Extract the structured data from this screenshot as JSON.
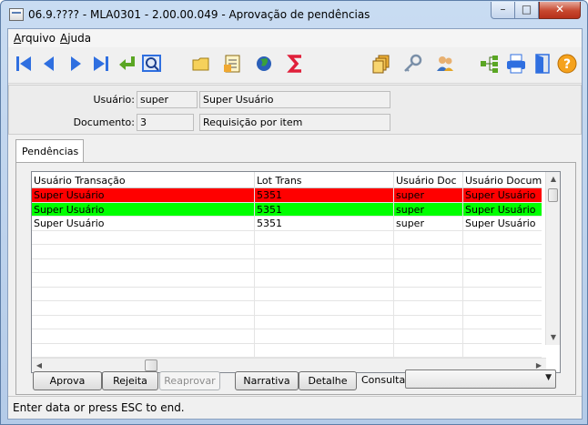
{
  "window": {
    "title": "06.9.???? - MLA0301 - 2.00.00.049 - Aprovação de pendências",
    "minimize": "–",
    "maximize": "□",
    "close": "✕"
  },
  "menu": {
    "arquivo_first": "A",
    "arquivo_rest": "rquivo",
    "ajuda_first": "A",
    "ajuda_rest": "juda"
  },
  "toolbar": {
    "icons": [
      "first-record-icon",
      "previous-record-icon",
      "next-record-icon",
      "last-record-icon",
      "return-icon",
      "search-icon",
      "folder-icon",
      "notepad-icon",
      "globe-icon",
      "sigma-icon",
      "stack-icon",
      "key-icon",
      "users-icon",
      "hierarchy-icon",
      "print-icon",
      "exit-door-icon",
      "help-icon"
    ],
    "colors": {
      "nav_blue": "#2f6fe0",
      "green": "#5aa623",
      "red": "#e0203a",
      "help_orange": "#f5a21d"
    }
  },
  "header": {
    "usuario_label": "Usuário:",
    "usuario_code": "super",
    "usuario_name": "Super Usuário",
    "documento_label": "Documento:",
    "documento_code": "3",
    "documento_name": "Requisição por item"
  },
  "tab": {
    "label": "Pendências"
  },
  "grid": {
    "columns": [
      "Usuário Transação",
      "Lot Trans",
      "Usuário Doc",
      "Usuário Documen"
    ],
    "rows": [
      {
        "cells": [
          "Super Usuário",
          "5351",
          "super",
          "Super Usuário"
        ],
        "color": "#ff0000"
      },
      {
        "cells": [
          "Super Usuário",
          "5351",
          "super",
          "Super Usuário"
        ],
        "color": "#00ff00"
      },
      {
        "cells": [
          "Super Usuário",
          "5351",
          "super",
          "Super Usuário"
        ],
        "color": "#ffffff"
      },
      {
        "cells": [
          "",
          "",
          "",
          ""
        ],
        "color": "#ffffff"
      },
      {
        "cells": [
          "",
          "",
          "",
          ""
        ],
        "color": "#ffffff"
      },
      {
        "cells": [
          "",
          "",
          "",
          ""
        ],
        "color": "#ffffff"
      },
      {
        "cells": [
          "",
          "",
          "",
          ""
        ],
        "color": "#ffffff"
      },
      {
        "cells": [
          "",
          "",
          "",
          ""
        ],
        "color": "#ffffff"
      },
      {
        "cells": [
          "",
          "",
          "",
          ""
        ],
        "color": "#ffffff"
      },
      {
        "cells": [
          "",
          "",
          "",
          ""
        ],
        "color": "#ffffff"
      },
      {
        "cells": [
          "",
          "",
          "",
          ""
        ],
        "color": "#ffffff"
      },
      {
        "cells": [
          "",
          "",
          "",
          ""
        ],
        "color": "#ffffff"
      }
    ]
  },
  "buttons": {
    "aprova": "Aprova",
    "rejeita": "Rejeita",
    "reaprovar": "Reaprovar",
    "narrativa": "Narrativa",
    "detalhe": "Detalhe"
  },
  "consulta": {
    "label": "Consulta:",
    "value": ""
  },
  "status": {
    "text": "Enter data or press ESC to end."
  }
}
